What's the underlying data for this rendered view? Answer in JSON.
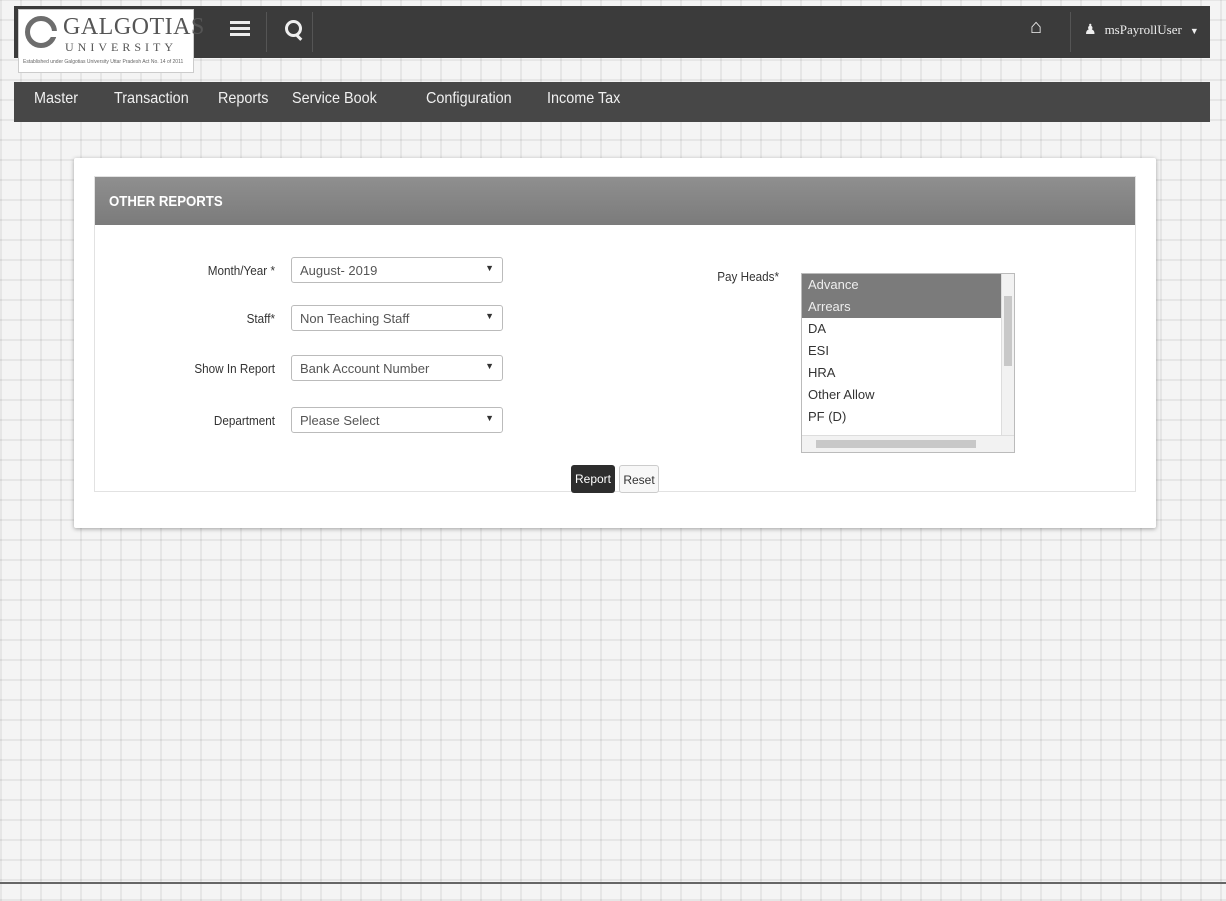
{
  "header": {
    "logo_title": "GALGOTIAS",
    "logo_subtitle": "UNIVERSITY",
    "logo_tagline": "Established under Galgotias University Uttar Pradesh Act No. 14 of 2011",
    "user_name": "msPayrollUser"
  },
  "nav": {
    "items": [
      "Master",
      "Transaction",
      "Reports",
      "Service Book",
      "Configuration",
      "Income Tax"
    ]
  },
  "panel": {
    "title": "OTHER REPORTS"
  },
  "form": {
    "month_year": {
      "label": "Month/Year *",
      "value": "August- 2019"
    },
    "staff": {
      "label": "Staff*",
      "value": "Non Teaching Staff"
    },
    "show_in_report": {
      "label": "Show In Report",
      "value": "Bank Account Number"
    },
    "department": {
      "label": "Department",
      "value": "Please Select"
    },
    "pay_heads": {
      "label": "Pay Heads*",
      "options": [
        "Advance",
        "Arrears",
        "DA",
        "ESI",
        "HRA",
        "Other Allow",
        "PF (D)"
      ],
      "selected": [
        "Advance",
        "Arrears"
      ]
    }
  },
  "buttons": {
    "report": "Report",
    "reset": "Reset"
  },
  "colors": {
    "header_bg": "#3b3b3b",
    "nav_bg": "#474747",
    "panel_head_bg": "#888888",
    "selected_option_bg": "#7b7b7b",
    "report_button_bg": "#2d2d2d"
  }
}
